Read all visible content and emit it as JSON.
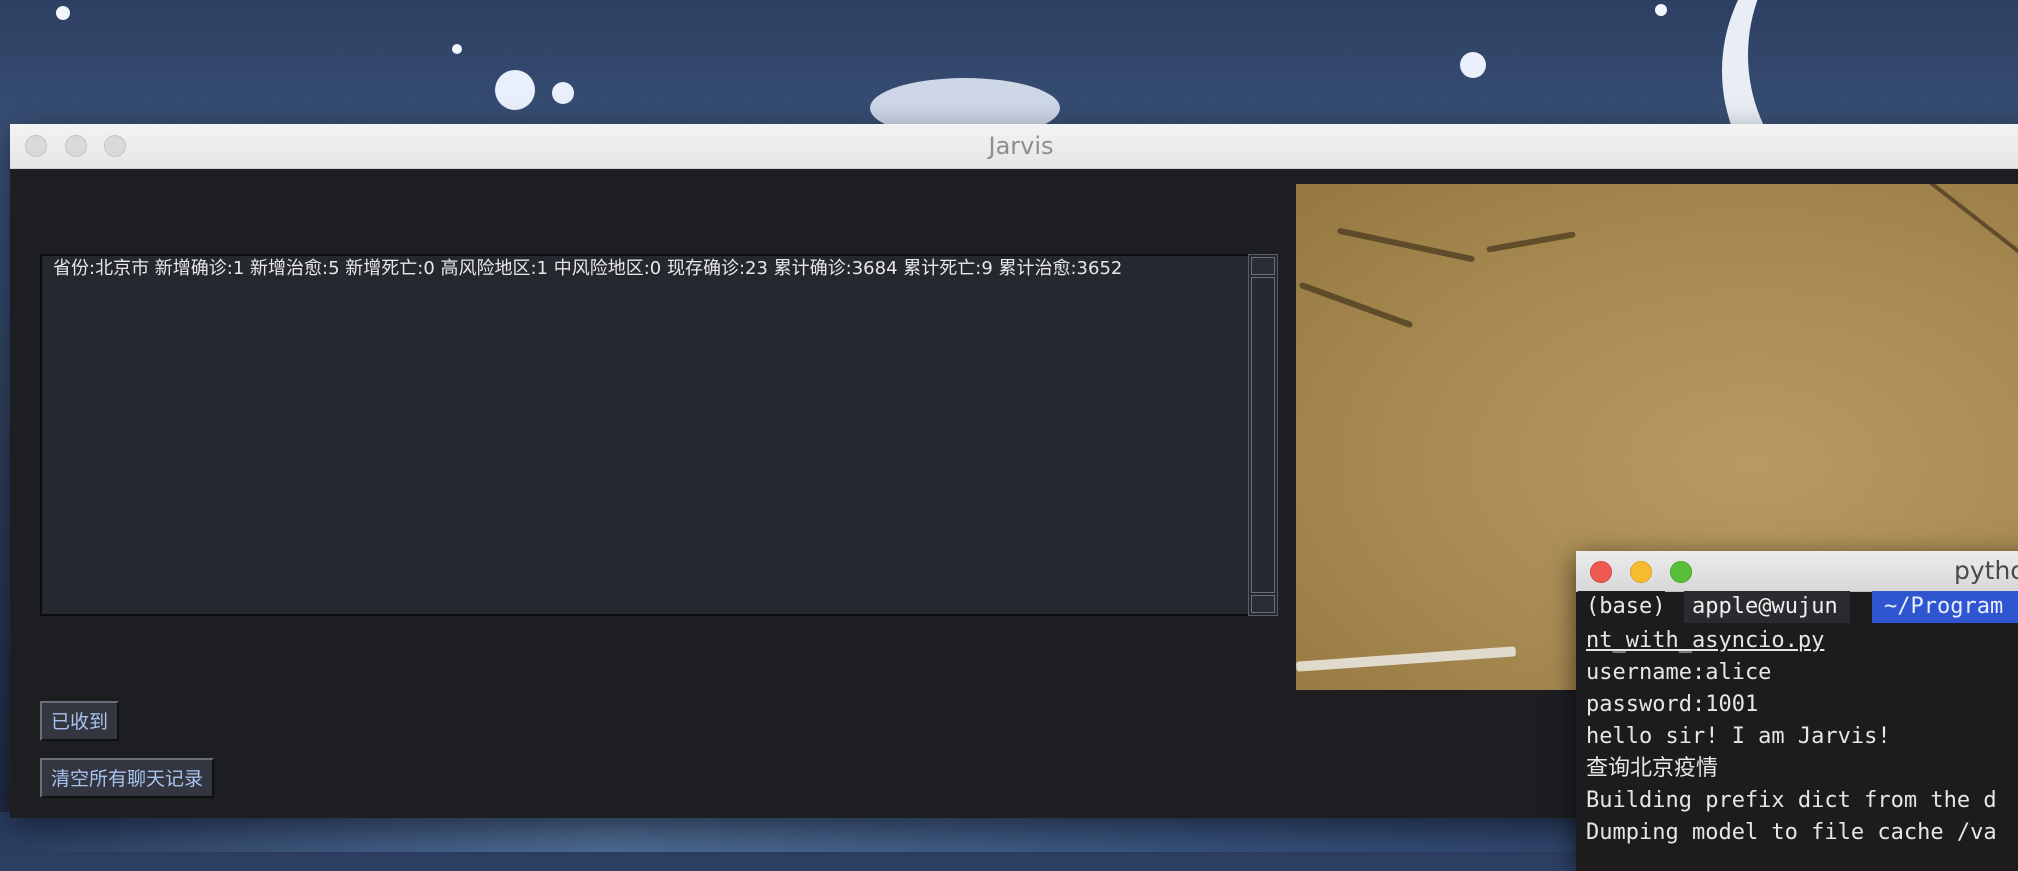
{
  "window": {
    "title": "Jarvis",
    "message_text": "省份:北京市 新增确诊:1 新增治愈:5 新增死亡:0 高风险地区:1 中风险地区:0 现存确诊:23 累计确诊:3684 累计死亡:9 累计治愈:3652",
    "received_button": "已收到",
    "clear_button": "清空所有聊天记录"
  },
  "terminal": {
    "title": "pytho",
    "prompt_env": "(base)",
    "prompt_user": "apple@wujun",
    "prompt_path": "~/Program",
    "lines": [
      "nt_with_asyncio.py",
      "username:alice",
      "password:1001",
      "hello sir! I am Jarvis!",
      "查询北京疫情",
      "Building prefix dict from the d",
      "Dumping model to file cache /va"
    ]
  },
  "colors": {
    "window_bg": "#1d1e22",
    "button_text": "#a8c2f0",
    "prompt_path_bg": "#2f56d0",
    "close_red": "#ee5a52",
    "minimize_yellow": "#f5bd2e",
    "zoom_green": "#57c038"
  },
  "icons": {
    "close": "close-icon",
    "minimize": "minimize-icon",
    "zoom": "zoom-icon"
  }
}
